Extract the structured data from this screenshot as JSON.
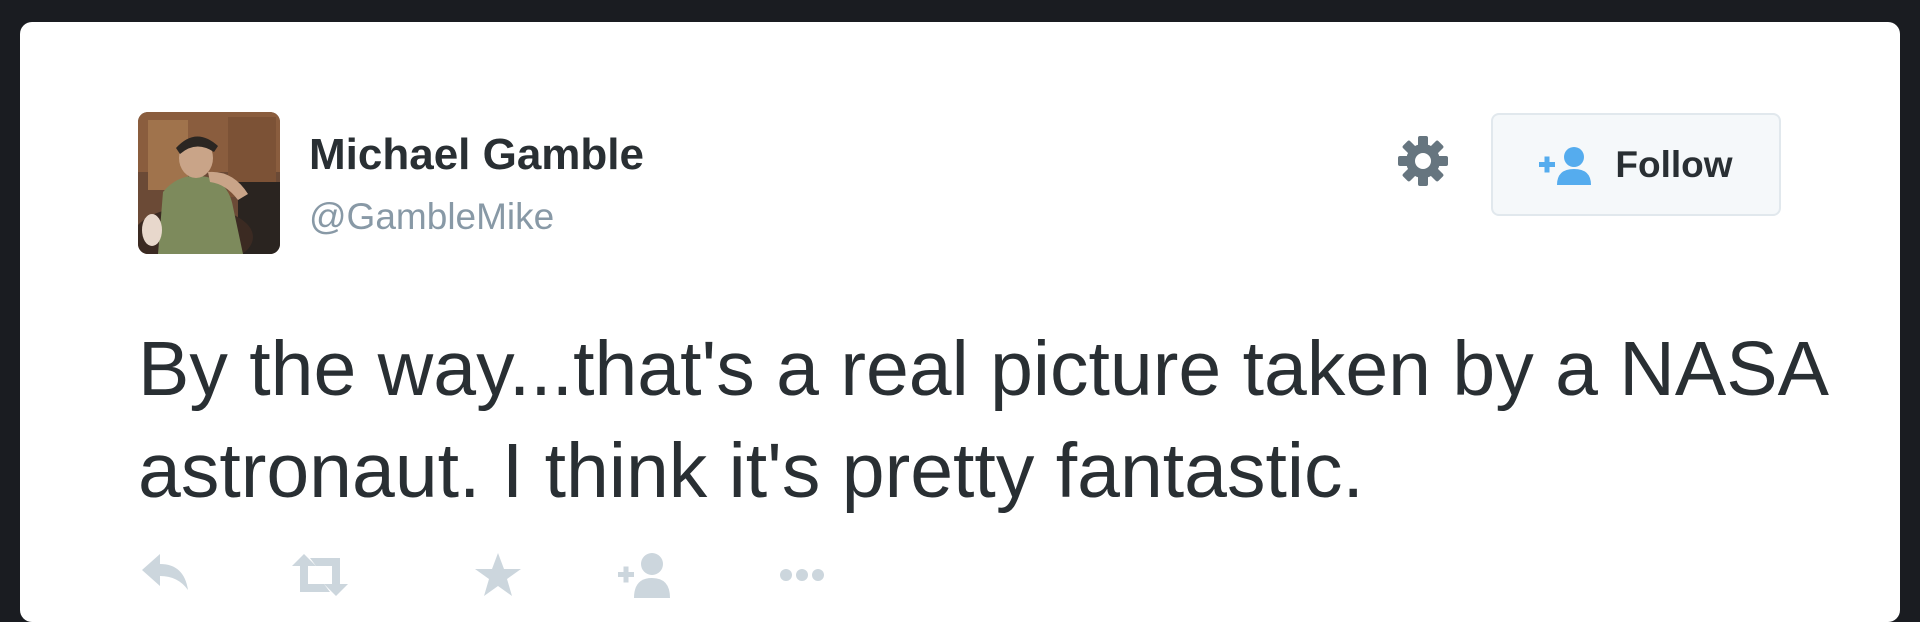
{
  "tweet": {
    "author": {
      "name": "Michael Gamble",
      "handle": "@GambleMike",
      "avatar_icon": "profile-photo"
    },
    "text": "By the way...that's a real picture taken by a NASA astronaut. I think it's pretty fantastic.",
    "follow_button": {
      "label": "Follow",
      "icon": "add-user-icon"
    },
    "settings_icon": "gear-icon",
    "actions": [
      {
        "name": "reply",
        "icon": "reply-icon"
      },
      {
        "name": "retweet",
        "icon": "retweet-icon"
      },
      {
        "name": "favorite",
        "icon": "star-icon"
      },
      {
        "name": "follow",
        "icon": "add-user-icon"
      },
      {
        "name": "more",
        "icon": "more-dots-icon"
      }
    ]
  },
  "colors": {
    "background": "#1a1c21",
    "card": "#ffffff",
    "text": "#292f33",
    "handle": "#8899a6",
    "action_icon": "#ccd6dd",
    "follow_icon": "#55acee",
    "gear": "#66757f"
  }
}
